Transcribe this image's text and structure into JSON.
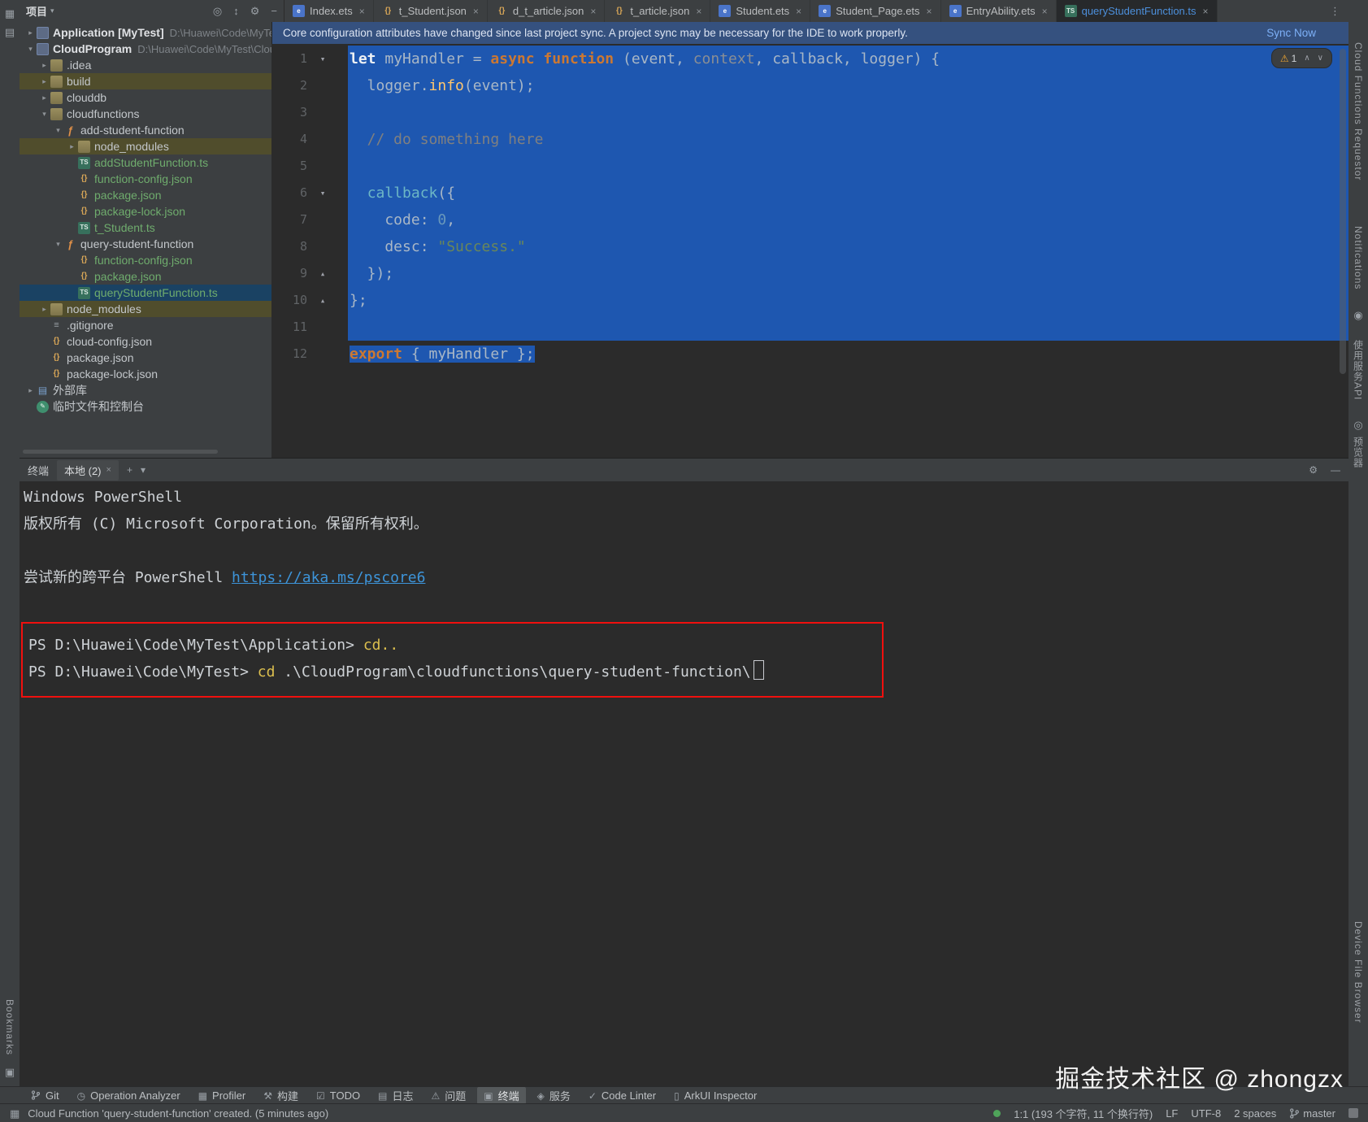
{
  "header": {
    "project_label": "项目",
    "icons": [
      {
        "glyph": "◎",
        "name": "locate-file-icon"
      },
      {
        "glyph": "↕",
        "name": "expand-collapse-icon"
      },
      {
        "glyph": "⚙",
        "name": "settings-gear-icon"
      },
      {
        "glyph": "−",
        "name": "hide-panel-icon"
      }
    ],
    "more": "⋮"
  },
  "tabs": [
    {
      "label": "Index.ets",
      "type": "ets"
    },
    {
      "label": "t_Student.json",
      "type": "json"
    },
    {
      "label": "d_t_article.json",
      "type": "json"
    },
    {
      "label": "t_article.json",
      "type": "json"
    },
    {
      "label": "Student.ets",
      "type": "ets"
    },
    {
      "label": "Student_Page.ets",
      "type": "ets"
    },
    {
      "label": "EntryAbility.ets",
      "type": "ets"
    },
    {
      "label": "queryStudentFunction.ts",
      "type": "ts",
      "active": true
    }
  ],
  "banner": {
    "message": "Core configuration attributes have changed since last project sync. A project sync may be necessary for the IDE to work properly.",
    "action": "Sync Now"
  },
  "tree": {
    "items": [
      {
        "d": 0,
        "a": ">",
        "i": "app",
        "t": "Application [MyTest]",
        "path": "D:\\Huawei\\Code\\MyTes",
        "b": 1
      },
      {
        "d": 0,
        "a": "v",
        "i": "app",
        "t": "CloudProgram",
        "path": "D:\\Huawei\\Code\\MyTest\\Clou",
        "b": 1
      },
      {
        "d": 1,
        "a": ">",
        "i": "folder",
        "t": ".idea"
      },
      {
        "d": 1,
        "a": ">",
        "i": "folder",
        "t": "build",
        "row": "ex"
      },
      {
        "d": 1,
        "a": ">",
        "i": "folder",
        "t": "clouddb"
      },
      {
        "d": 1,
        "a": "v",
        "i": "folder",
        "t": "cloudfunctions"
      },
      {
        "d": 2,
        "a": "v",
        "i": "fx",
        "t": "add-student-function"
      },
      {
        "d": 3,
        "a": ">",
        "i": "folder",
        "t": "node_modules",
        "row": "ex"
      },
      {
        "d": 3,
        "a": "",
        "i": "ts",
        "t": "addStudentFunction.ts",
        "c": "added"
      },
      {
        "d": 3,
        "a": "",
        "i": "json",
        "t": "function-config.json",
        "c": "added"
      },
      {
        "d": 3,
        "a": "",
        "i": "json",
        "t": "package.json",
        "c": "added"
      },
      {
        "d": 3,
        "a": "",
        "i": "json",
        "t": "package-lock.json",
        "c": "added"
      },
      {
        "d": 3,
        "a": "",
        "i": "ts",
        "t": "t_Student.ts",
        "c": "added"
      },
      {
        "d": 2,
        "a": "v",
        "i": "fx",
        "t": "query-student-function"
      },
      {
        "d": 3,
        "a": "",
        "i": "json",
        "t": "function-config.json",
        "c": "added"
      },
      {
        "d": 3,
        "a": "",
        "i": "json",
        "t": "package.json",
        "c": "added"
      },
      {
        "d": 3,
        "a": "",
        "i": "ts",
        "t": "queryStudentFunction.ts",
        "c": "added",
        "row": "sel"
      },
      {
        "d": 1,
        "a": ">",
        "i": "folder",
        "t": "node_modules",
        "row": "ex"
      },
      {
        "d": 1,
        "a": "",
        "i": "txt",
        "t": ".gitignore"
      },
      {
        "d": 1,
        "a": "",
        "i": "json",
        "t": "cloud-config.json"
      },
      {
        "d": 1,
        "a": "",
        "i": "json",
        "t": "package.json"
      },
      {
        "d": 1,
        "a": "",
        "i": "json",
        "t": "package-lock.json"
      },
      {
        "d": 0,
        "a": ">",
        "i": "lib",
        "t": "外部库"
      },
      {
        "d": 0,
        "a": "",
        "i": "scratch",
        "t": "临时文件和控制台"
      }
    ]
  },
  "editor": {
    "warning_count": "1",
    "lines": [
      {
        "n": 1,
        "fold": "down",
        "sel": "full",
        "segs": [
          [
            "wb",
            "let"
          ],
          [
            "p",
            " myHandler = "
          ],
          [
            "kw",
            "async"
          ],
          [
            "p",
            " "
          ],
          [
            "kw",
            "function"
          ],
          [
            "p",
            " (event, "
          ],
          [
            "gr",
            "context"
          ],
          [
            "p",
            ", callback, logger) {"
          ]
        ]
      },
      {
        "n": 2,
        "sel": "full",
        "segs": [
          [
            "p",
            "  logger."
          ],
          [
            "fn",
            "info"
          ],
          [
            "p",
            "(event);"
          ]
        ]
      },
      {
        "n": 3,
        "sel": "full",
        "segs": []
      },
      {
        "n": 4,
        "sel": "full",
        "segs": [
          [
            "cm",
            "  // do something here"
          ]
        ]
      },
      {
        "n": 5,
        "sel": "full",
        "segs": []
      },
      {
        "n": 6,
        "fold": "down",
        "sel": "full",
        "segs": [
          [
            "p",
            "  "
          ],
          [
            "call",
            "callback"
          ],
          [
            "p",
            "({"
          ]
        ]
      },
      {
        "n": 7,
        "sel": "full",
        "segs": [
          [
            "p",
            "    code: "
          ],
          [
            "num",
            "0"
          ],
          [
            "p",
            ","
          ]
        ]
      },
      {
        "n": 8,
        "sel": "full",
        "segs": [
          [
            "p",
            "    desc: "
          ],
          [
            "str",
            "\"Success.\""
          ]
        ]
      },
      {
        "n": 9,
        "fold": "up",
        "sel": "full",
        "segs": [
          [
            "p",
            "  });"
          ]
        ]
      },
      {
        "n": 10,
        "fold": "up",
        "sel": "full",
        "segs": [
          [
            "p",
            "};"
          ]
        ]
      },
      {
        "n": 11,
        "sel": "full",
        "segs": []
      },
      {
        "n": 12,
        "sel": "text",
        "segs": [
          [
            "kw",
            "export"
          ],
          [
            "p",
            " { myHandler };"
          ]
        ]
      }
    ]
  },
  "terminal": {
    "title": "终端",
    "tab": "本地 (2)",
    "lines": [
      {
        "segs": [
          [
            "p",
            "Windows PowerShell"
          ]
        ]
      },
      {
        "segs": [
          [
            "p",
            "版权所有 (C) Microsoft Corporation。保留所有权利。"
          ]
        ]
      },
      {
        "segs": []
      },
      {
        "segs": [
          [
            "p",
            "尝试新的跨平台 PowerShell "
          ],
          [
            "link",
            "https://aka.ms/pscore6"
          ]
        ]
      },
      {
        "segs": []
      }
    ],
    "boxed": [
      {
        "segs": [
          [
            "p",
            "PS D:\\Huawei\\Code\\MyTest\\Application> "
          ],
          [
            "cmd",
            "cd.."
          ]
        ]
      },
      {
        "segs": [
          [
            "p",
            "PS D:\\Huawei\\Code\\MyTest> "
          ],
          [
            "cmd",
            "cd"
          ],
          [
            "p",
            " .\\CloudProgram\\cloudfunctions\\query-student-function\\"
          ],
          [
            "cursor",
            ""
          ]
        ]
      }
    ]
  },
  "toolbar": {
    "items": [
      {
        "icon": "git",
        "label": "Git"
      },
      {
        "icon": "analyzer",
        "label": "Operation Analyzer"
      },
      {
        "icon": "profiler",
        "label": "Profiler"
      },
      {
        "icon": "build",
        "label": "构建"
      },
      {
        "icon": "todo",
        "label": "TODO"
      },
      {
        "icon": "log",
        "label": "日志"
      },
      {
        "icon": "problems",
        "label": "问题"
      },
      {
        "icon": "terminal",
        "label": "终端",
        "active": true
      },
      {
        "icon": "services",
        "label": "服务"
      },
      {
        "icon": "lint",
        "label": "Code Linter"
      },
      {
        "icon": "arkui",
        "label": "ArkUI Inspector"
      }
    ]
  },
  "statusbar": {
    "message": "Cloud Function 'query-student-function' created. (5 minutes ago)",
    "caret": "1:1 (193 个字符, 11 个换行符)",
    "line_ending": "LF",
    "encoding": "UTF-8",
    "indent": "2 spaces",
    "branch": "master"
  },
  "stripes": {
    "left_bottom_label": "Bookmarks",
    "right": [
      {
        "type": "label",
        "text": "Cloud Functions Requestor",
        "gap": 52
      },
      {
        "type": "label",
        "text": "Notifications",
        "gap": 56
      },
      {
        "type": "icon",
        "glyph": "◉",
        "gap": 24,
        "name": "tool-window-icon"
      },
      {
        "type": "label",
        "text": "使用服务API",
        "gap": 24
      },
      {
        "type": "icon",
        "glyph": "◎",
        "gap": 24,
        "name": "tool-window-icon"
      },
      {
        "type": "label",
        "text": "预览器",
        "gap": 8
      },
      {
        "type": "spacer"
      },
      {
        "type": "label",
        "text": "Device File Browser",
        "gapBottom": 78
      }
    ]
  },
  "watermark": "掘金技术社区 @ zhongzx"
}
